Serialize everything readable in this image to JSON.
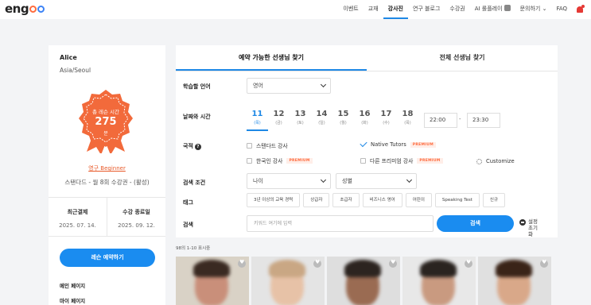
{
  "nav": {
    "logo": "engoo",
    "items": [
      "이벤트",
      "교재",
      "강사진",
      "연구 블로그",
      "수강권",
      "AI 롤플레이",
      "문의하기",
      "FAQ"
    ],
    "active": "강사진"
  },
  "profile": {
    "name": "Alice",
    "location": "Asia/Seoul",
    "badge": {
      "title": "총 레슨 시간",
      "value": "275",
      "unit": "분",
      "color": "#f26a3b"
    },
    "level": "영구 Beginner",
    "plan": "스탠다드 - 월 8회 수강권 - (활성)",
    "last_payment_label": "최근결제",
    "last_payment_value": "2025. 07. 14.",
    "end_date_label": "수강 종료일",
    "end_date_value": "2025. 09. 12.",
    "book_button": "레슨 예약하기",
    "links": [
      "메인 페이지",
      "마이 페이지"
    ]
  },
  "search": {
    "tabs": [
      "예약 가능한 선생님 찾기",
      "전체 선생님 찾기"
    ],
    "active_tab": 0,
    "language_label": "학습할 언어",
    "language_value": "영어",
    "datetime_label": "날짜와 시간",
    "dates": [
      {
        "day": "11",
        "weekday": "(목)"
      },
      {
        "day": "12",
        "weekday": "(금)"
      },
      {
        "day": "13",
        "weekday": "(토)"
      },
      {
        "day": "14",
        "weekday": "(일)"
      },
      {
        "day": "15",
        "weekday": "(월)"
      },
      {
        "day": "16",
        "weekday": "(화)"
      },
      {
        "day": "17",
        "weekday": "(수)"
      },
      {
        "day": "18",
        "weekday": "(목)"
      }
    ],
    "time_from": "22:00",
    "time_sep": "-",
    "time_to": "23:30",
    "nationality_label": "국적",
    "nationality_options": {
      "standard": "스탠다드 강사",
      "native": "Native Tutors",
      "korean": "한국인 강사",
      "freemium": "다른 프리미엄 강사",
      "premium_tag": "PREMIUM",
      "customize": "Customize"
    },
    "conditions_label": "검색 조건",
    "age_value": "나이",
    "gender_value": "성별",
    "tags_label": "태그",
    "tags": [
      "3년 이상의 교육 경력",
      "상급자",
      "초급자",
      "비즈니스 영어",
      "어린이",
      "Speaking Test",
      "신규"
    ],
    "keyword_label": "검색",
    "keyword_placeholder": "키워드 여기에 입력",
    "search_button": "검색",
    "reset_label": "설정 초기화"
  },
  "results": {
    "count_text": "98의 1-10 표시중",
    "tutor_cards": [
      {
        "bg": "#d9d2c6",
        "face": "#c98f7a",
        "hair": "#3a2a22"
      },
      {
        "bg": "#e4e4e4",
        "face": "#e7c2a7",
        "hair": "#c9a784"
      },
      {
        "bg": "#dedede",
        "face": "#9a6b52",
        "hair": "#2c2420"
      },
      {
        "bg": "#e8e8e8",
        "face": "#c99a80",
        "hair": "#2a2420"
      },
      {
        "bg": "#e0e0e0",
        "face": "#d9a889",
        "hair": "#3a2418"
      }
    ]
  }
}
